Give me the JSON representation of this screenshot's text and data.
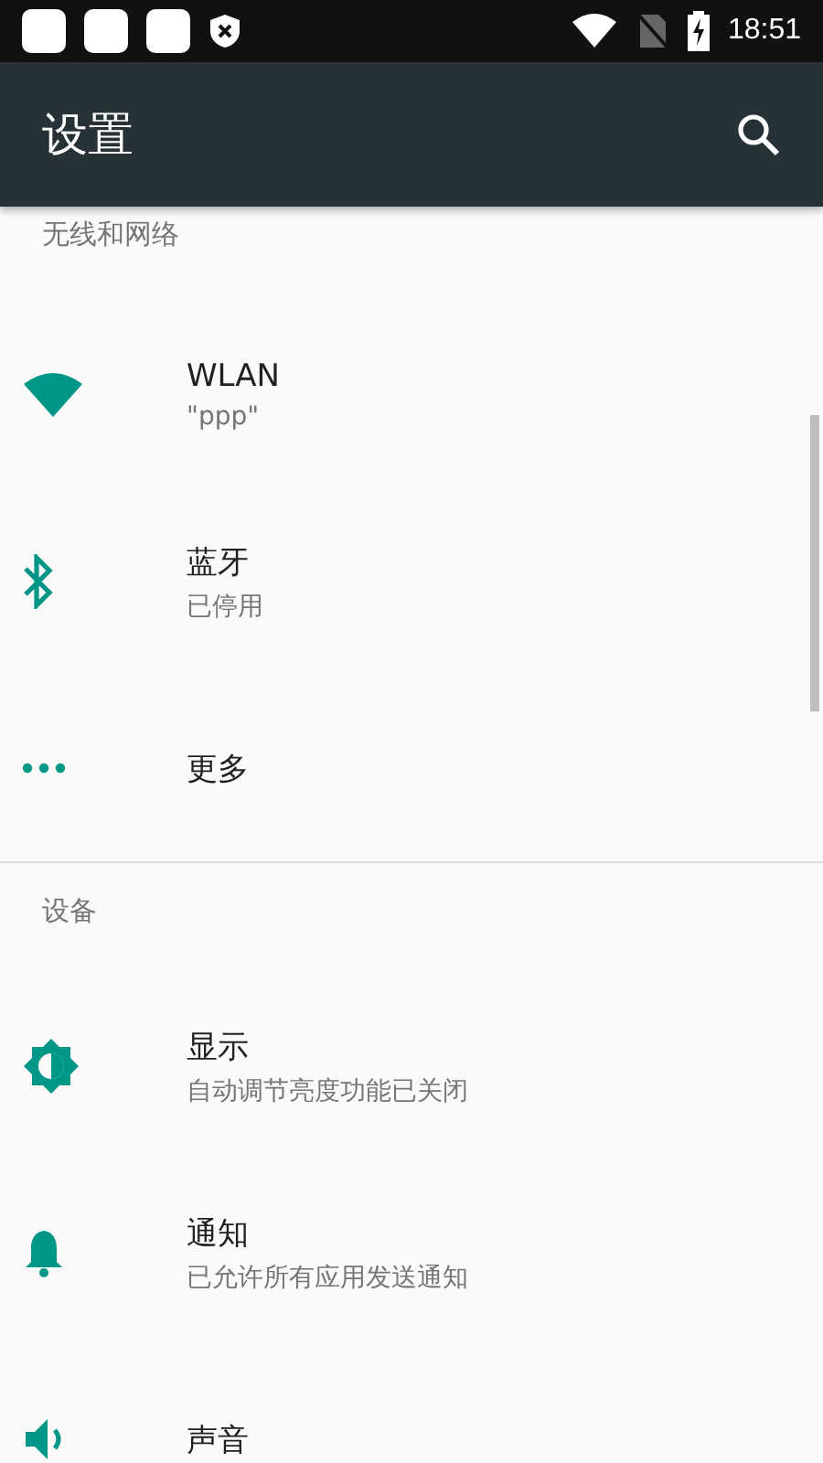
{
  "status_bar": {
    "time": "18:51"
  },
  "app_bar": {
    "title": "设置"
  },
  "sections": [
    {
      "title": "无线和网络",
      "items": [
        {
          "kind": "wifi",
          "title": "WLAN",
          "summary": "\"ppp\""
        },
        {
          "kind": "bluetooth",
          "title": "蓝牙",
          "summary": "已停用"
        },
        {
          "kind": "more",
          "title": "更多"
        }
      ]
    },
    {
      "title": "设备",
      "items": [
        {
          "kind": "display",
          "title": "显示",
          "summary": "自动调节亮度功能已关闭"
        },
        {
          "kind": "bell",
          "title": "通知",
          "summary": "已允许所有应用发送通知"
        },
        {
          "kind": "sound",
          "title": "声音"
        }
      ]
    }
  ]
}
